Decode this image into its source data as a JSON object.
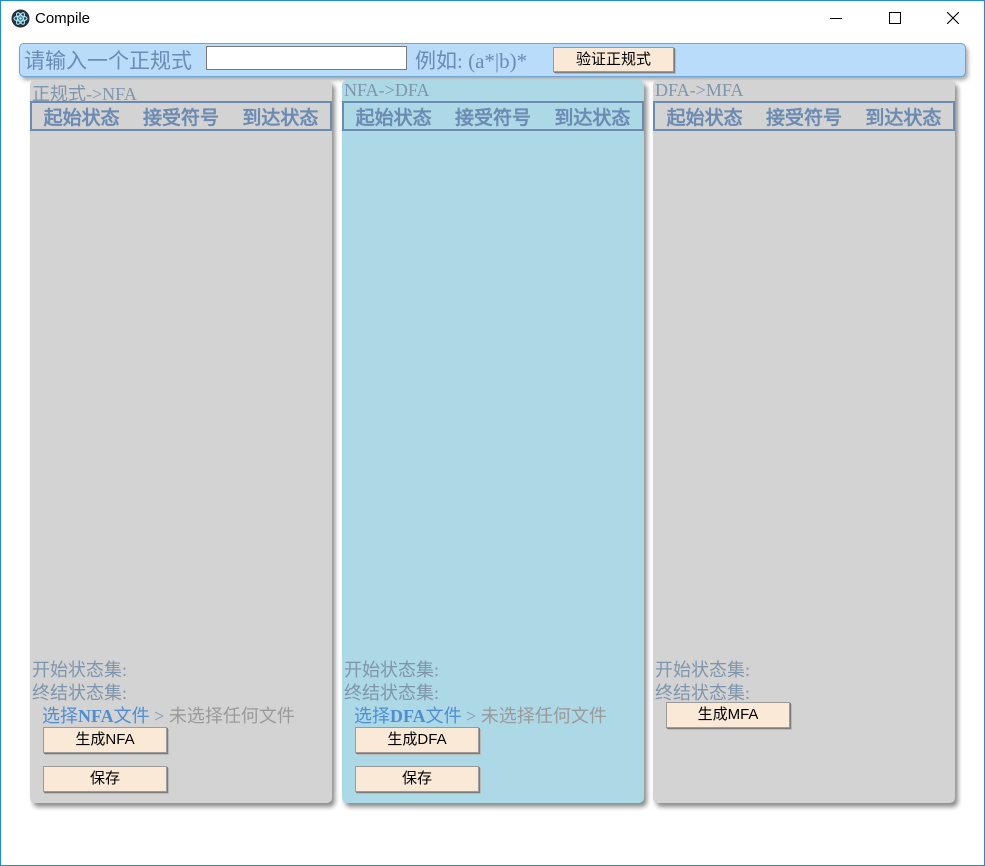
{
  "window": {
    "title": "Compile"
  },
  "topbar": {
    "prompt": "请输入一个正规式",
    "regex_value": "",
    "example": "例如: (a*|b)*",
    "verify_button": "验证正规式"
  },
  "panels": [
    {
      "title": "正规式->NFA",
      "columns": [
        "起始状态",
        "接受符号",
        "到达状态"
      ],
      "start_set_label": "开始状态集:",
      "final_set_label": "终结状态集:",
      "file_choose_prefix": "选择",
      "file_choose_bold": "NFA",
      "file_choose_suffix": "文件",
      "file_separator": " > ",
      "file_status": "未选择任何文件",
      "generate_button": "生成NFA",
      "save_button": "保存"
    },
    {
      "title": "NFA->DFA",
      "columns": [
        "起始状态",
        "接受符号",
        "到达状态"
      ],
      "start_set_label": "开始状态集:",
      "final_set_label": "终结状态集:",
      "file_choose_prefix": "选择",
      "file_choose_bold": "DFA",
      "file_choose_suffix": "文件",
      "file_separator": " > ",
      "file_status": "未选择任何文件",
      "generate_button": "生成DFA",
      "save_button": "保存"
    },
    {
      "title": "DFA->MFA",
      "columns": [
        "起始状态",
        "接受符号",
        "到达状态"
      ],
      "start_set_label": "开始状态集:",
      "final_set_label": "终结状态集:",
      "generate_button": "生成MFA"
    }
  ],
  "colors": {
    "topbar_bg": "#b9dcfb",
    "panel_gray": "#d3d3d3",
    "panel_blue": "#add8e6",
    "button_bg": "#fbe9d7",
    "label_text": "#7f95ac",
    "link_text": "#4f8ed3"
  },
  "icons": [
    "app-icon",
    "minimize-icon",
    "maximize-icon",
    "close-icon"
  ]
}
